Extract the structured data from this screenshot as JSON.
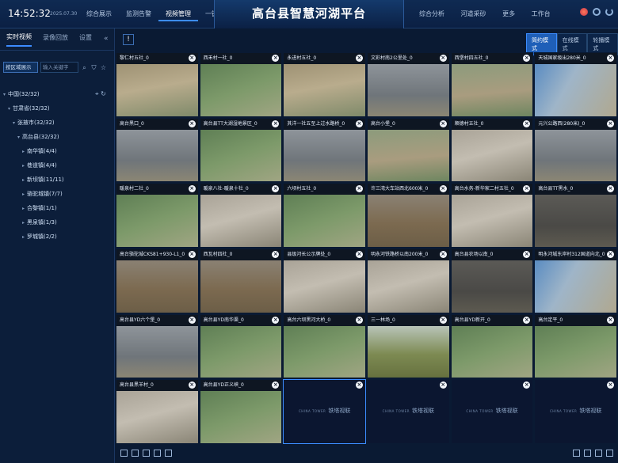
{
  "header": {
    "time": "14:52:32",
    "date": "2025.07.30",
    "title": "高台县智慧河湖平台",
    "nav_left": [
      "综合展示",
      "监测告警",
      "视频管理",
      "一键巡河"
    ],
    "nav_left_active": 2,
    "nav_right": [
      "综合分析",
      "河道采砂",
      "更多",
      "工作台"
    ]
  },
  "sidebar": {
    "tabs": [
      "实时视频",
      "录像回放",
      "设置"
    ],
    "active_tab": 0,
    "collapse_label": "«",
    "region_select": "按区域展示",
    "search_placeholder": "输入关键字",
    "tree": [
      {
        "label": "中国(32/32)",
        "level": 0
      },
      {
        "label": "甘肃省(32/32)",
        "level": 1
      },
      {
        "label": "张掖市(32/32)",
        "level": 2
      },
      {
        "label": "高台县(32/32)",
        "level": 3
      },
      {
        "label": "南华镇(4/4)",
        "level": 4
      },
      {
        "label": "巷道镇(4/4)",
        "level": 4
      },
      {
        "label": "新坝镇(11/11)",
        "level": 4
      },
      {
        "label": "骆驼城镇(7/7)",
        "level": 4
      },
      {
        "label": "合黎镇(1/1)",
        "level": 4
      },
      {
        "label": "黑泉镇(1/3)",
        "level": 4
      },
      {
        "label": "罗城镇(2/2)",
        "level": 4
      }
    ]
  },
  "toolbar": {
    "warn_icon": "!",
    "modes": [
      "简约模式",
      "在线模式",
      "轮播模式"
    ],
    "active_mode": 0
  },
  "cells": [
    {
      "label": "黎仁村五社_0",
      "scene": "arid"
    },
    {
      "label": "西禾村一社_0",
      "scene": "green"
    },
    {
      "label": "永进村五社_0",
      "scene": "arid"
    },
    {
      "label": "文彩村南2公里处_0",
      "scene": "grey"
    },
    {
      "label": "西堡村四五社_0",
      "scene": "village"
    },
    {
      "label": "天城国家级出280米_0",
      "scene": "bluewall"
    },
    {
      "label": "高台黑口_0",
      "scene": "grey"
    },
    {
      "label": "高台县TT大湖湿地景区_0",
      "scene": "green"
    },
    {
      "label": "其洋一社五至上过水路桥_0",
      "scene": "grey"
    },
    {
      "label": "高台小堡_0",
      "scene": "village"
    },
    {
      "label": "顺德村五社_0",
      "scene": "riverbed"
    },
    {
      "label": "元兴公路西(280米)_0",
      "scene": "grey"
    },
    {
      "label": "暖泉村二社_0",
      "scene": "green"
    },
    {
      "label": "暖泉八社-暖泉十社_0",
      "scene": "riverbed"
    },
    {
      "label": "六坝村五社_0",
      "scene": "green"
    },
    {
      "label": "许三湾大车站西北600米_0",
      "scene": "brown"
    },
    {
      "label": "高台水务-新华家二村五社_0",
      "scene": "riverbed"
    },
    {
      "label": "高台县TT黑水_0",
      "scene": "dark"
    },
    {
      "label": "高台骆驼城CKS81+930-L1_0",
      "scene": "brown"
    },
    {
      "label": "西瓦村四社_0",
      "scene": "brown"
    },
    {
      "label": "县级河长公示牌处_0",
      "scene": "riverbed"
    },
    {
      "label": "明永河铁路桥以南200米_0",
      "scene": "riverbed"
    },
    {
      "label": "高台县农场以南_0",
      "scene": "dark"
    },
    {
      "label": "明永河城东岸村312国道向北_0",
      "scene": "bluewall"
    },
    {
      "label": "高台县YD六个堡_0",
      "scene": "grey"
    },
    {
      "label": "高台县YD南华渠_0",
      "scene": "green"
    },
    {
      "label": "高台六坝黑河大桥_0",
      "scene": "green"
    },
    {
      "label": "三一林场_0",
      "scene": "olive"
    },
    {
      "label": "高台县YD新开_0",
      "scene": "green"
    },
    {
      "label": "高台定平_0",
      "scene": "green"
    },
    {
      "label": "高台县黑羊村_0",
      "scene": "riverbed"
    },
    {
      "label": "高台县YD正义峡_0",
      "scene": "green"
    },
    {
      "label": "",
      "scene": "empty"
    },
    {
      "label": "",
      "scene": "empty"
    },
    {
      "label": "",
      "scene": "empty"
    },
    {
      "label": "",
      "scene": "empty"
    }
  ],
  "empty_logo": {
    "small": "CHINA TOWER",
    "text": "铁塔视联"
  },
  "colors": {
    "accent": "#3c8cff",
    "background": "#0a1a33",
    "panel": "#0c1e3a"
  }
}
